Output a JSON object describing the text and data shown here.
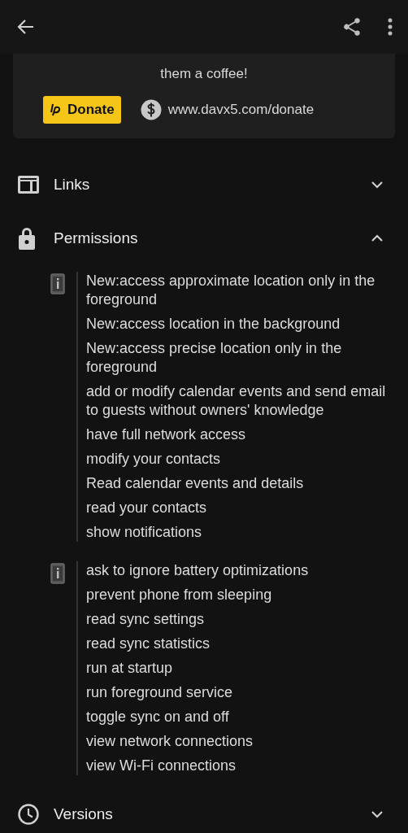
{
  "donate_card": {
    "text": "them a coffee!",
    "button": "Donate",
    "link": "www.davx5.com/donate"
  },
  "sections": [
    {
      "title": "Links",
      "expanded": false
    },
    {
      "title": "Permissions",
      "expanded": true,
      "groups": [
        {
          "items": [
            "New:access approximate location only in the foreground",
            "New:access location in the background",
            "New:access precise location only in the foreground",
            "add or modify calendar events and send email to guests without owners' knowledge",
            "have full network access",
            "modify your contacts",
            "Read calendar events and details",
            "read your contacts",
            "show notifications"
          ]
        },
        {
          "items": [
            "ask to ignore battery optimizations",
            "prevent phone from sleeping",
            "read sync settings",
            "read sync statistics",
            "run at startup",
            "run foreground service",
            "toggle sync on and off",
            "view network connections",
            "view Wi-Fi connections"
          ]
        }
      ]
    },
    {
      "title": "Versions",
      "expanded": false
    }
  ]
}
